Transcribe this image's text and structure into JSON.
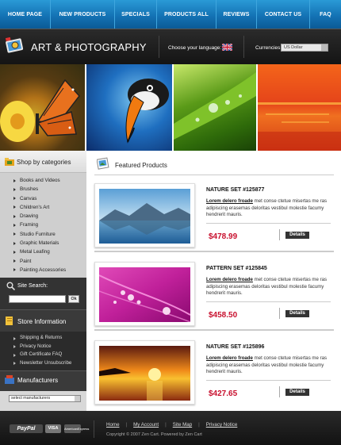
{
  "nav": {
    "items": [
      "HOME PAGE",
      "NEW PRODUCTS",
      "SPECIALS",
      "PRODUCTS ALL",
      "REVIEWS",
      "CONTACT US",
      "FAQ"
    ]
  },
  "header": {
    "brand": "ART & PHOTOGRAPHY",
    "language_label": "Choose your language:",
    "currency_label": "Currencies:",
    "currency_value": "US Dollar"
  },
  "sidebar": {
    "categories_title": "Shop by categories",
    "categories": [
      "Books and Videos",
      "Brushes",
      "Canvas",
      "Children's Art",
      "Drawing",
      "Framing",
      "Studio Furniture",
      "Graphic Materials",
      "Metal Leafing",
      "Paint",
      "Painting Accessories"
    ],
    "search_title": "Site Search:",
    "search_button": "Ok",
    "info_title": "Store Information",
    "info_items": [
      "Shipping & Returns",
      "Privacy Notice",
      "Gift Certificate FAQ",
      "Newsletter Unsubscribe"
    ],
    "manufacturers_title": "Manufacturers",
    "manufacturers_select": "select manufacturers"
  },
  "main": {
    "featured_title": "Featured Products",
    "products": [
      {
        "name": "NATURE SET #125877",
        "desc_bold": "Lorem delero froade",
        "desc": " met conse ctetue misertas me ras adipiscing erasemas deloritas vestibul molestie facumy hendrerit mauris.",
        "price": "$478.99",
        "button": "Details"
      },
      {
        "name": "PATTERN SET #125845",
        "desc_bold": "Lorem delero froade",
        "desc": " met conse ctetue misertas me ras adipiscing erasemas deloritas vestibul molestie facumy hendrerit mauris.",
        "price": "$458.50",
        "button": "Details"
      },
      {
        "name": "NATURE SET #125896",
        "desc_bold": "Lorem delero froade",
        "desc": " met conse ctetue misertas me ras adipiscing erasemas deloritas vestibul molestie facumy hendrerit mauris.",
        "price": "$427.65",
        "button": "Details"
      }
    ]
  },
  "footer": {
    "links": [
      "Home",
      "My Account",
      "Site Map",
      "Privacy Notice"
    ],
    "copyright": "Copyright © 2007 Zen Cart. Powered by Zen Cart",
    "payments": [
      "PayPal",
      "VISA",
      "AmericanExpress"
    ]
  },
  "colors": {
    "nav_blue": "#1473b5",
    "price_red": "#c8102e",
    "dark_bg": "#141414"
  }
}
